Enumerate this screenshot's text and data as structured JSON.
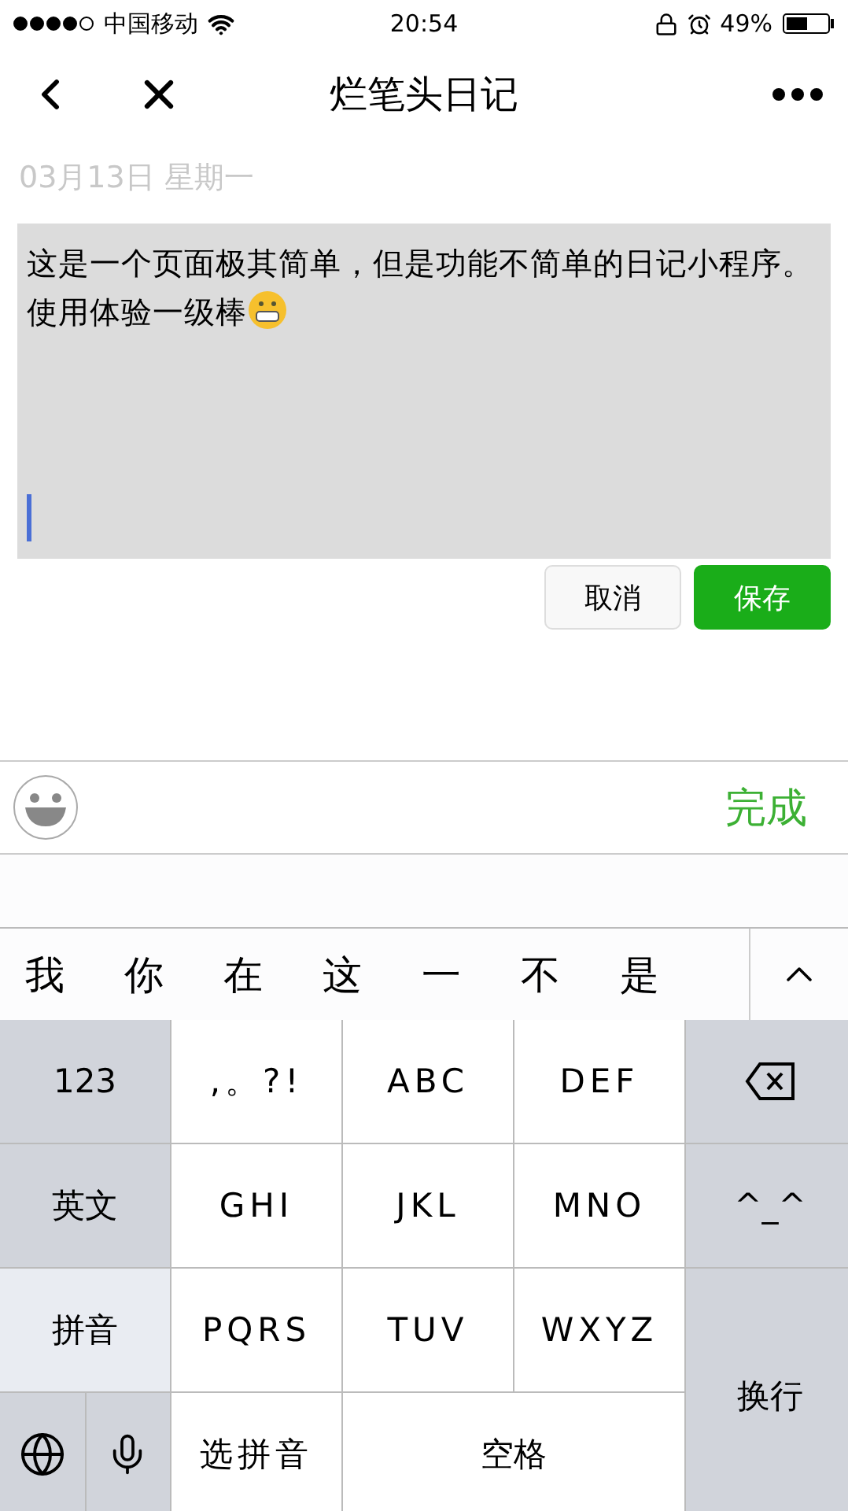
{
  "status_bar": {
    "carrier": "中国移动",
    "time": "20:54",
    "battery": "49%"
  },
  "nav": {
    "title": "烂笔头日记"
  },
  "date": "03月13日  星期一",
  "editor": {
    "value": "这是一个页面极其简单，但是功能不简单的日记小程序。使用体验一级棒"
  },
  "buttons": [
    {
      "label": "取消",
      "kind": "plain"
    },
    {
      "label": "保存",
      "kind": "primary"
    }
  ],
  "toolbar": {
    "done": "完成"
  },
  "candidates": [
    "我",
    "你",
    "在",
    "这",
    "一",
    "不",
    "是"
  ],
  "keyboard": [
    {
      "label": "123",
      "kind": "side",
      "selected": false
    },
    {
      "label": ",。?!",
      "kind": "key",
      "selected": false
    },
    {
      "label": "ABC",
      "kind": "key",
      "selected": false
    },
    {
      "label": "DEF",
      "kind": "key",
      "selected": false
    },
    {
      "kind": "delete",
      "selected": false
    },
    {
      "label": "英文",
      "kind": "side",
      "selected": false
    },
    {
      "label": "GHI",
      "kind": "key",
      "selected": false
    },
    {
      "label": "JKL",
      "kind": "key",
      "selected": false
    },
    {
      "label": "MNO",
      "kind": "key",
      "selected": false
    },
    {
      "label": "^_^",
      "kind": "side",
      "selected": false
    },
    {
      "label": "拼音",
      "kind": "side",
      "selected": true
    },
    {
      "label": "PQRS",
      "kind": "key",
      "selected": false
    },
    {
      "label": "TUV",
      "kind": "key",
      "selected": false
    },
    {
      "label": "WXYZ",
      "kind": "key",
      "selected": false
    },
    {
      "label": "换行",
      "kind": "enter",
      "selected": false
    },
    {
      "kind": "lang",
      "selected": false
    },
    {
      "label": "选拼音",
      "kind": "key",
      "selected": false
    },
    {
      "label": "空格",
      "kind": "space",
      "selected": false
    }
  ]
}
